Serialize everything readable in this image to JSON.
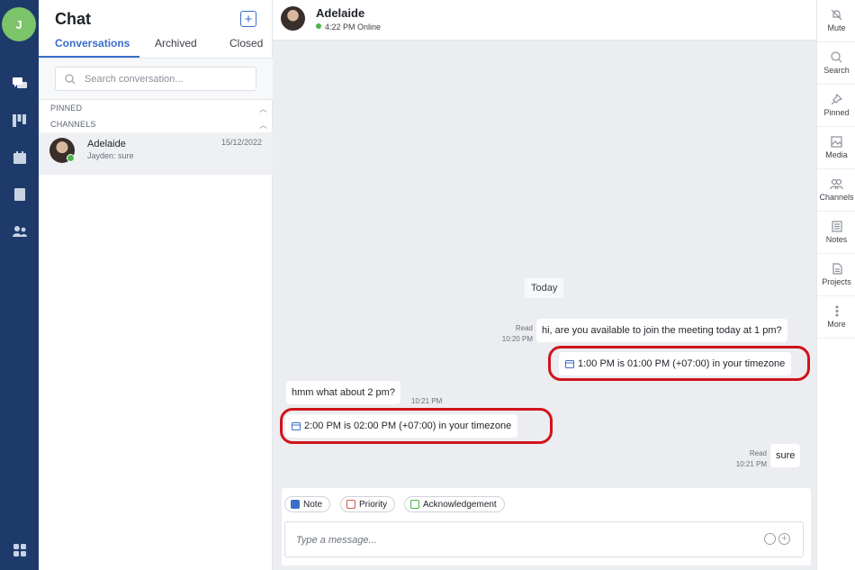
{
  "user": {
    "initial": "J"
  },
  "sidebar_list": {
    "title": "Chat",
    "new_chat_icon": "plus-icon",
    "tabs": [
      {
        "label": "Conversations",
        "active": true
      },
      {
        "label": "Archived",
        "active": false
      },
      {
        "label": "Closed",
        "active": false
      }
    ],
    "search": {
      "placeholder": "Search conversation..."
    },
    "sections": {
      "pinned": "PINNED",
      "channels": "CHANNELS"
    },
    "conversations": [
      {
        "name": "Adelaide",
        "preview": "Jayden: sure",
        "date": "15/12/2022",
        "online": true
      }
    ]
  },
  "chat": {
    "contact_name": "Adelaide",
    "status": "4:22 PM Online",
    "day_label": "Today",
    "messages": [
      {
        "direction": "outgoing",
        "text": "hi, are you available to join the meeting today at 1 pm?",
        "status": "Read",
        "time": "10:20 PM"
      },
      {
        "direction": "outgoing",
        "kind": "timezone",
        "text": "1:00 PM is 01:00 PM (+07:00) in your timezone"
      },
      {
        "direction": "incoming",
        "text": "hmm what about 2 pm?",
        "time": "10:21 PM"
      },
      {
        "direction": "incoming",
        "kind": "timezone",
        "text": "2:00 PM is 02:00 PM (+07:00) in your timezone"
      },
      {
        "direction": "outgoing",
        "text": "sure",
        "status": "Read",
        "time": "10:21 PM"
      }
    ],
    "composer": {
      "chips": [
        {
          "label": "Note",
          "color": "#3a6ec9"
        },
        {
          "label": "Priority",
          "color": "#d9534f"
        },
        {
          "label": "Acknowledgement",
          "color": "#4fb34a"
        }
      ],
      "placeholder": "Type a message..."
    }
  },
  "actions": [
    {
      "label": "Mute",
      "icon": "bell-off-icon"
    },
    {
      "label": "Search",
      "icon": "search-icon"
    },
    {
      "label": "Pinned",
      "icon": "pin-icon"
    },
    {
      "label": "Media",
      "icon": "image-icon"
    },
    {
      "label": "Channels",
      "icon": "people-icon"
    },
    {
      "label": "Notes",
      "icon": "notes-icon"
    },
    {
      "label": "Projects",
      "icon": "file-icon"
    },
    {
      "label": "More",
      "icon": "more-vertical-icon"
    }
  ],
  "colors": {
    "rail": "#1d3a6b",
    "accent": "#3a6ec9",
    "highlight": "#d0141b",
    "online": "#4fb34a"
  }
}
